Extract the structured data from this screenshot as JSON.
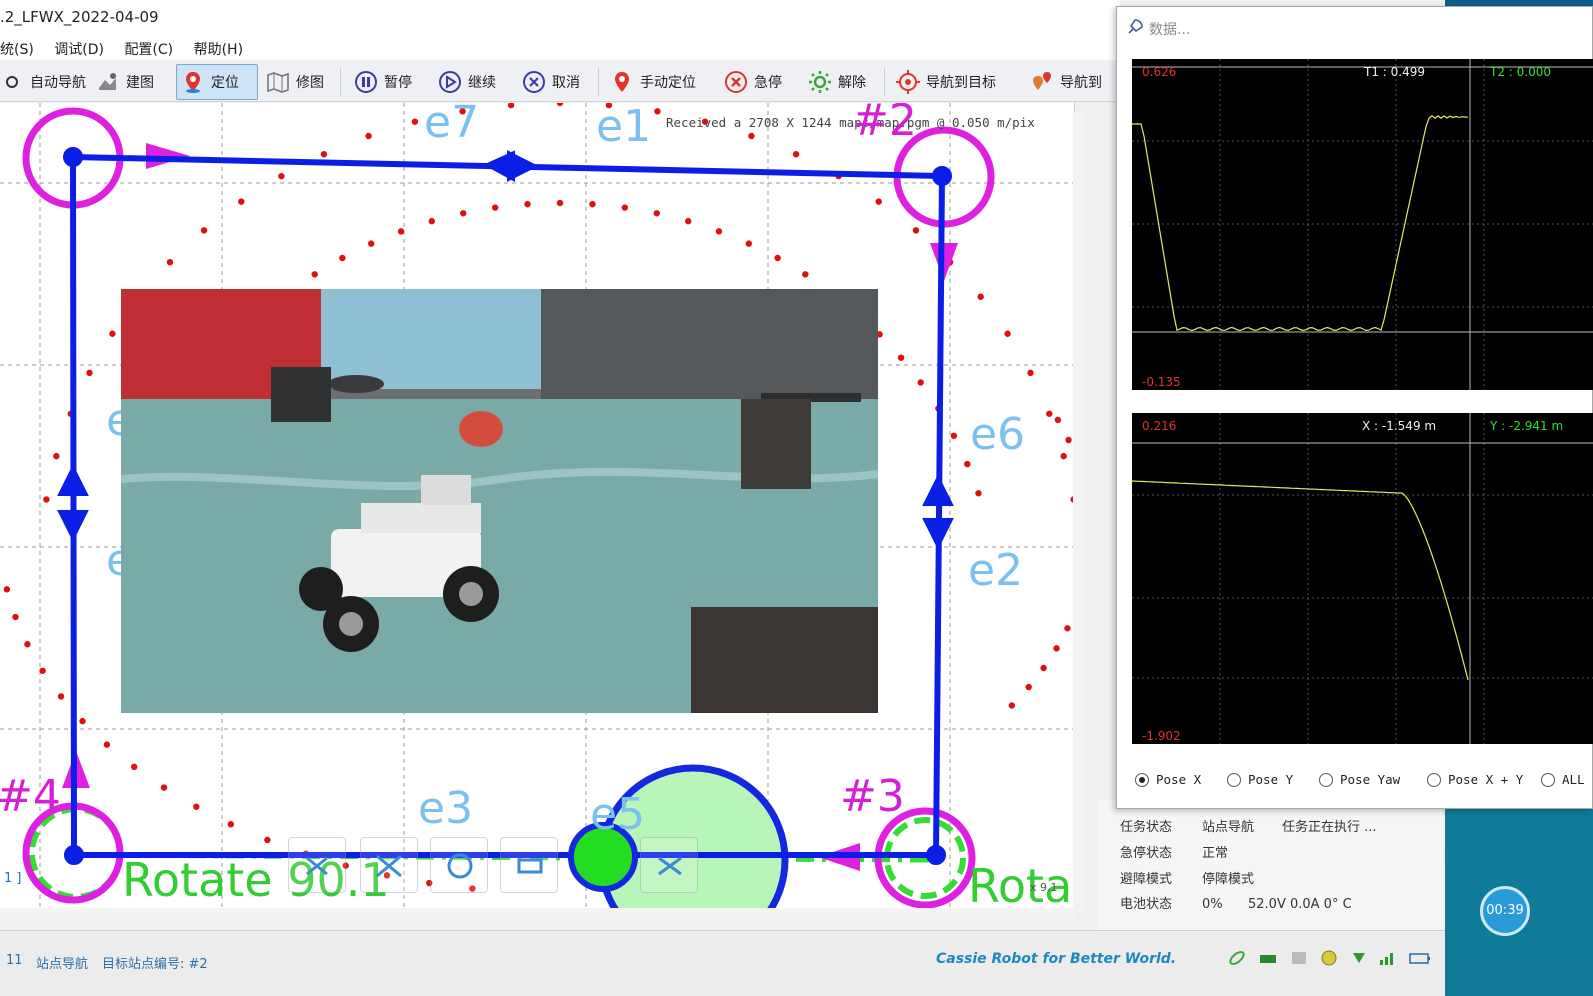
{
  "window": {
    "title": ".2_LFWX_2022-04-09"
  },
  "menu": [
    "统(S)",
    "调试(D)",
    "配置(C)",
    "帮助(H)"
  ],
  "toolbar": {
    "auto_nav": "自动导航",
    "build_map": "建图",
    "localize": "定位",
    "edit_map": "修图",
    "pause": "暂停",
    "resume": "继续",
    "cancel": "取消",
    "manual_localize": "手动定位",
    "estop": "急停",
    "release": "解除",
    "nav_to_target": "导航到目标",
    "nav_to": "导航到"
  },
  "map": {
    "received_text": "Received a 2708 X 1244 maps/map.pgm @ 0.050 m/pix",
    "edges": [
      "e7",
      "e1",
      "e6",
      "e2",
      "e3",
      "e5",
      "e",
      "e"
    ],
    "points": [
      "#2",
      "#3",
      "#4"
    ],
    "rotate_left": "Rotate 90.1",
    "rotate_right": "Rota",
    "left_marker": "1 ]",
    "coord_readout": "x 9.1"
  },
  "popup": {
    "title": "数据...",
    "plot1": {
      "top_left": "0.626",
      "bottom_left": "-0.135",
      "t1": "T1 : 0.499",
      "t2": "T2 : 0.000"
    },
    "plot2": {
      "top_left": "0.216",
      "bottom_left": "-1.902",
      "x": "X : -1.549 m",
      "y": "Y : -2.941 m"
    },
    "radios": [
      "Pose X",
      "Pose Y",
      "Pose Yaw",
      "Pose X + Y",
      "ALL"
    ],
    "selected_radio": "Pose X"
  },
  "status_panel": {
    "rows": [
      {
        "label": "任务状态",
        "value": "站点导航",
        "extra": "任务正在执行 ..."
      },
      {
        "label": "急停状态",
        "value": "正常",
        "extra": ""
      },
      {
        "label": "避障模式",
        "value": "停障模式",
        "extra": ""
      },
      {
        "label": "电池状态",
        "value": "0%",
        "extra": "52.0V     0.0A     0° C"
      }
    ]
  },
  "statusbar": {
    "num": "11",
    "mode": "站点导航",
    "target": "目标站点编号: #2",
    "slogan": "Cassie Robot for Better World."
  },
  "timer": "00:39",
  "colors": {
    "path_blue": "#0a1ee6",
    "route_green": "#33dd33",
    "station_magenta": "#e020e0",
    "edge_label": "#7cc0ee",
    "plot_line": "#e8e860"
  }
}
